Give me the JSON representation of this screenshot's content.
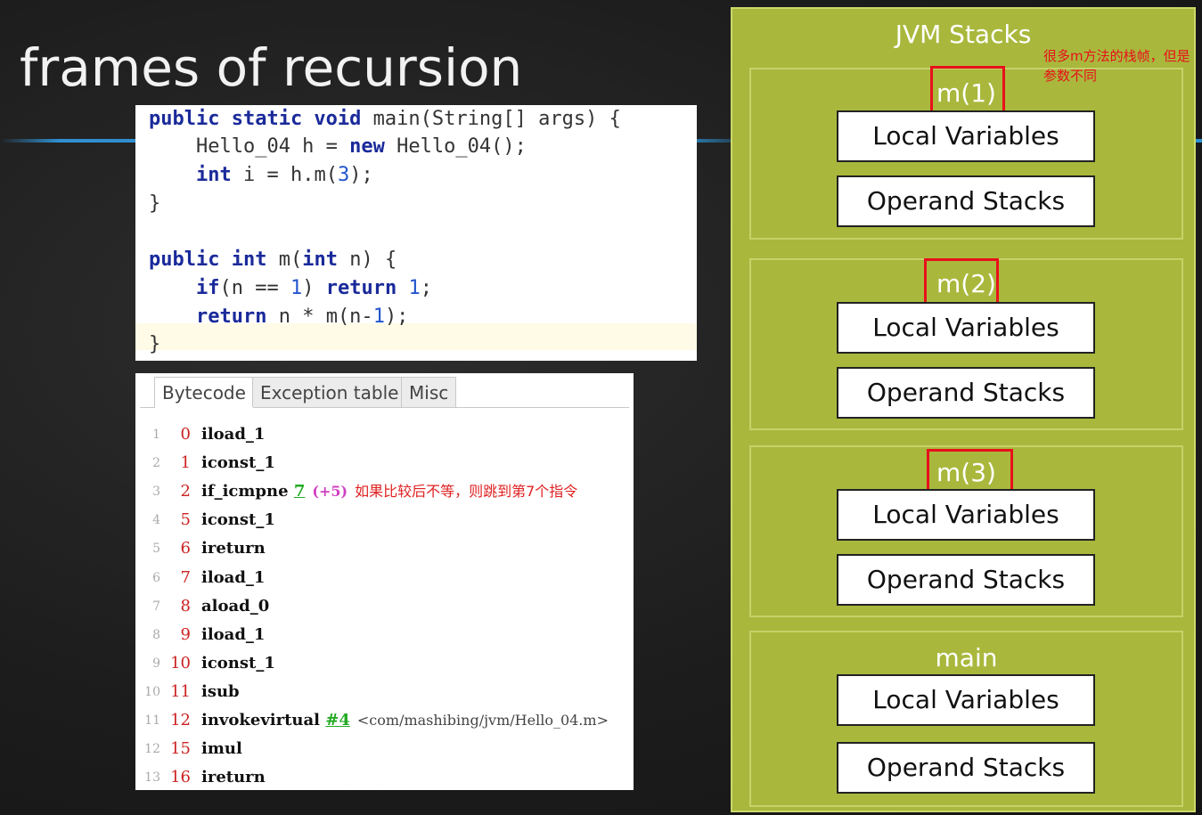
{
  "slide": {
    "title": "frames of recursion"
  },
  "code": {
    "lines": [
      {
        "t1": "public static void",
        "t2": " main(String[] args) {"
      },
      {
        "t1": "    Hello_04 h = ",
        "k": "new",
        "t2": " Hello_04();"
      },
      {
        "k": "int",
        "t2": " i = h.m(",
        "n": "3",
        "t3": ");"
      },
      {
        "t1": "}"
      },
      {
        "k": "public",
        "k2": "int",
        "t2": " m(",
        "k3": "int",
        "t3": " n) {"
      },
      {
        "k": "if",
        "t2": "(n == ",
        "n": "1",
        "t3": ") ",
        "k2": "return",
        "t4": " ",
        "n2": "1",
        "t5": ";"
      },
      {
        "k": "return",
        "t2": " n * m(n-",
        "n": "1",
        "t3": ");"
      },
      {
        "t1": "}"
      }
    ]
  },
  "bytecode": {
    "tabs": [
      "Bytecode",
      "Exception table",
      "Misc"
    ],
    "rows": [
      {
        "ln": "1",
        "off": "0",
        "op": "iload_1"
      },
      {
        "ln": "2",
        "off": "1",
        "op": "iconst_1"
      },
      {
        "ln": "3",
        "off": "2",
        "op": "if_icmpne",
        "arg": "7",
        "rel": "(+5)",
        "note": "如果比较后不等，则跳到第7个指令"
      },
      {
        "ln": "4",
        "off": "5",
        "op": "iconst_1"
      },
      {
        "ln": "5",
        "off": "6",
        "op": "ireturn"
      },
      {
        "ln": "6",
        "off": "7",
        "op": "iload_1"
      },
      {
        "ln": "7",
        "off": "8",
        "op": "aload_0"
      },
      {
        "ln": "8",
        "off": "9",
        "op": "iload_1"
      },
      {
        "ln": "9",
        "off": "10",
        "op": "iconst_1"
      },
      {
        "ln": "10",
        "off": "11",
        "op": "isub"
      },
      {
        "ln": "11",
        "off": "12",
        "op": "invokevirtual",
        "arg": "#4",
        "ref": "<com/mashibing/jvm/Hello_04.m>"
      },
      {
        "ln": "12",
        "off": "15",
        "op": "imul"
      },
      {
        "ln": "13",
        "off": "16",
        "op": "ireturn"
      }
    ]
  },
  "jvm": {
    "title": "JVM Stacks",
    "note": "很多m方法的栈帧，但是参数不同",
    "frames": [
      {
        "label": "m(1)",
        "local": "Local Variables",
        "operand": "Operand Stacks"
      },
      {
        "label": "m(2)",
        "local": "Local Variables",
        "operand": "Operand Stacks"
      },
      {
        "label": "m(3)",
        "local": "Local Variables",
        "operand": "Operand Stacks"
      },
      {
        "label": "main",
        "local": "Local Variables",
        "operand": "Operand Stacks"
      }
    ]
  },
  "colors": {
    "panel_green": "#a9b83c",
    "highlight_red": "#e8101a",
    "keyword_blue": "#1a2a9a"
  }
}
